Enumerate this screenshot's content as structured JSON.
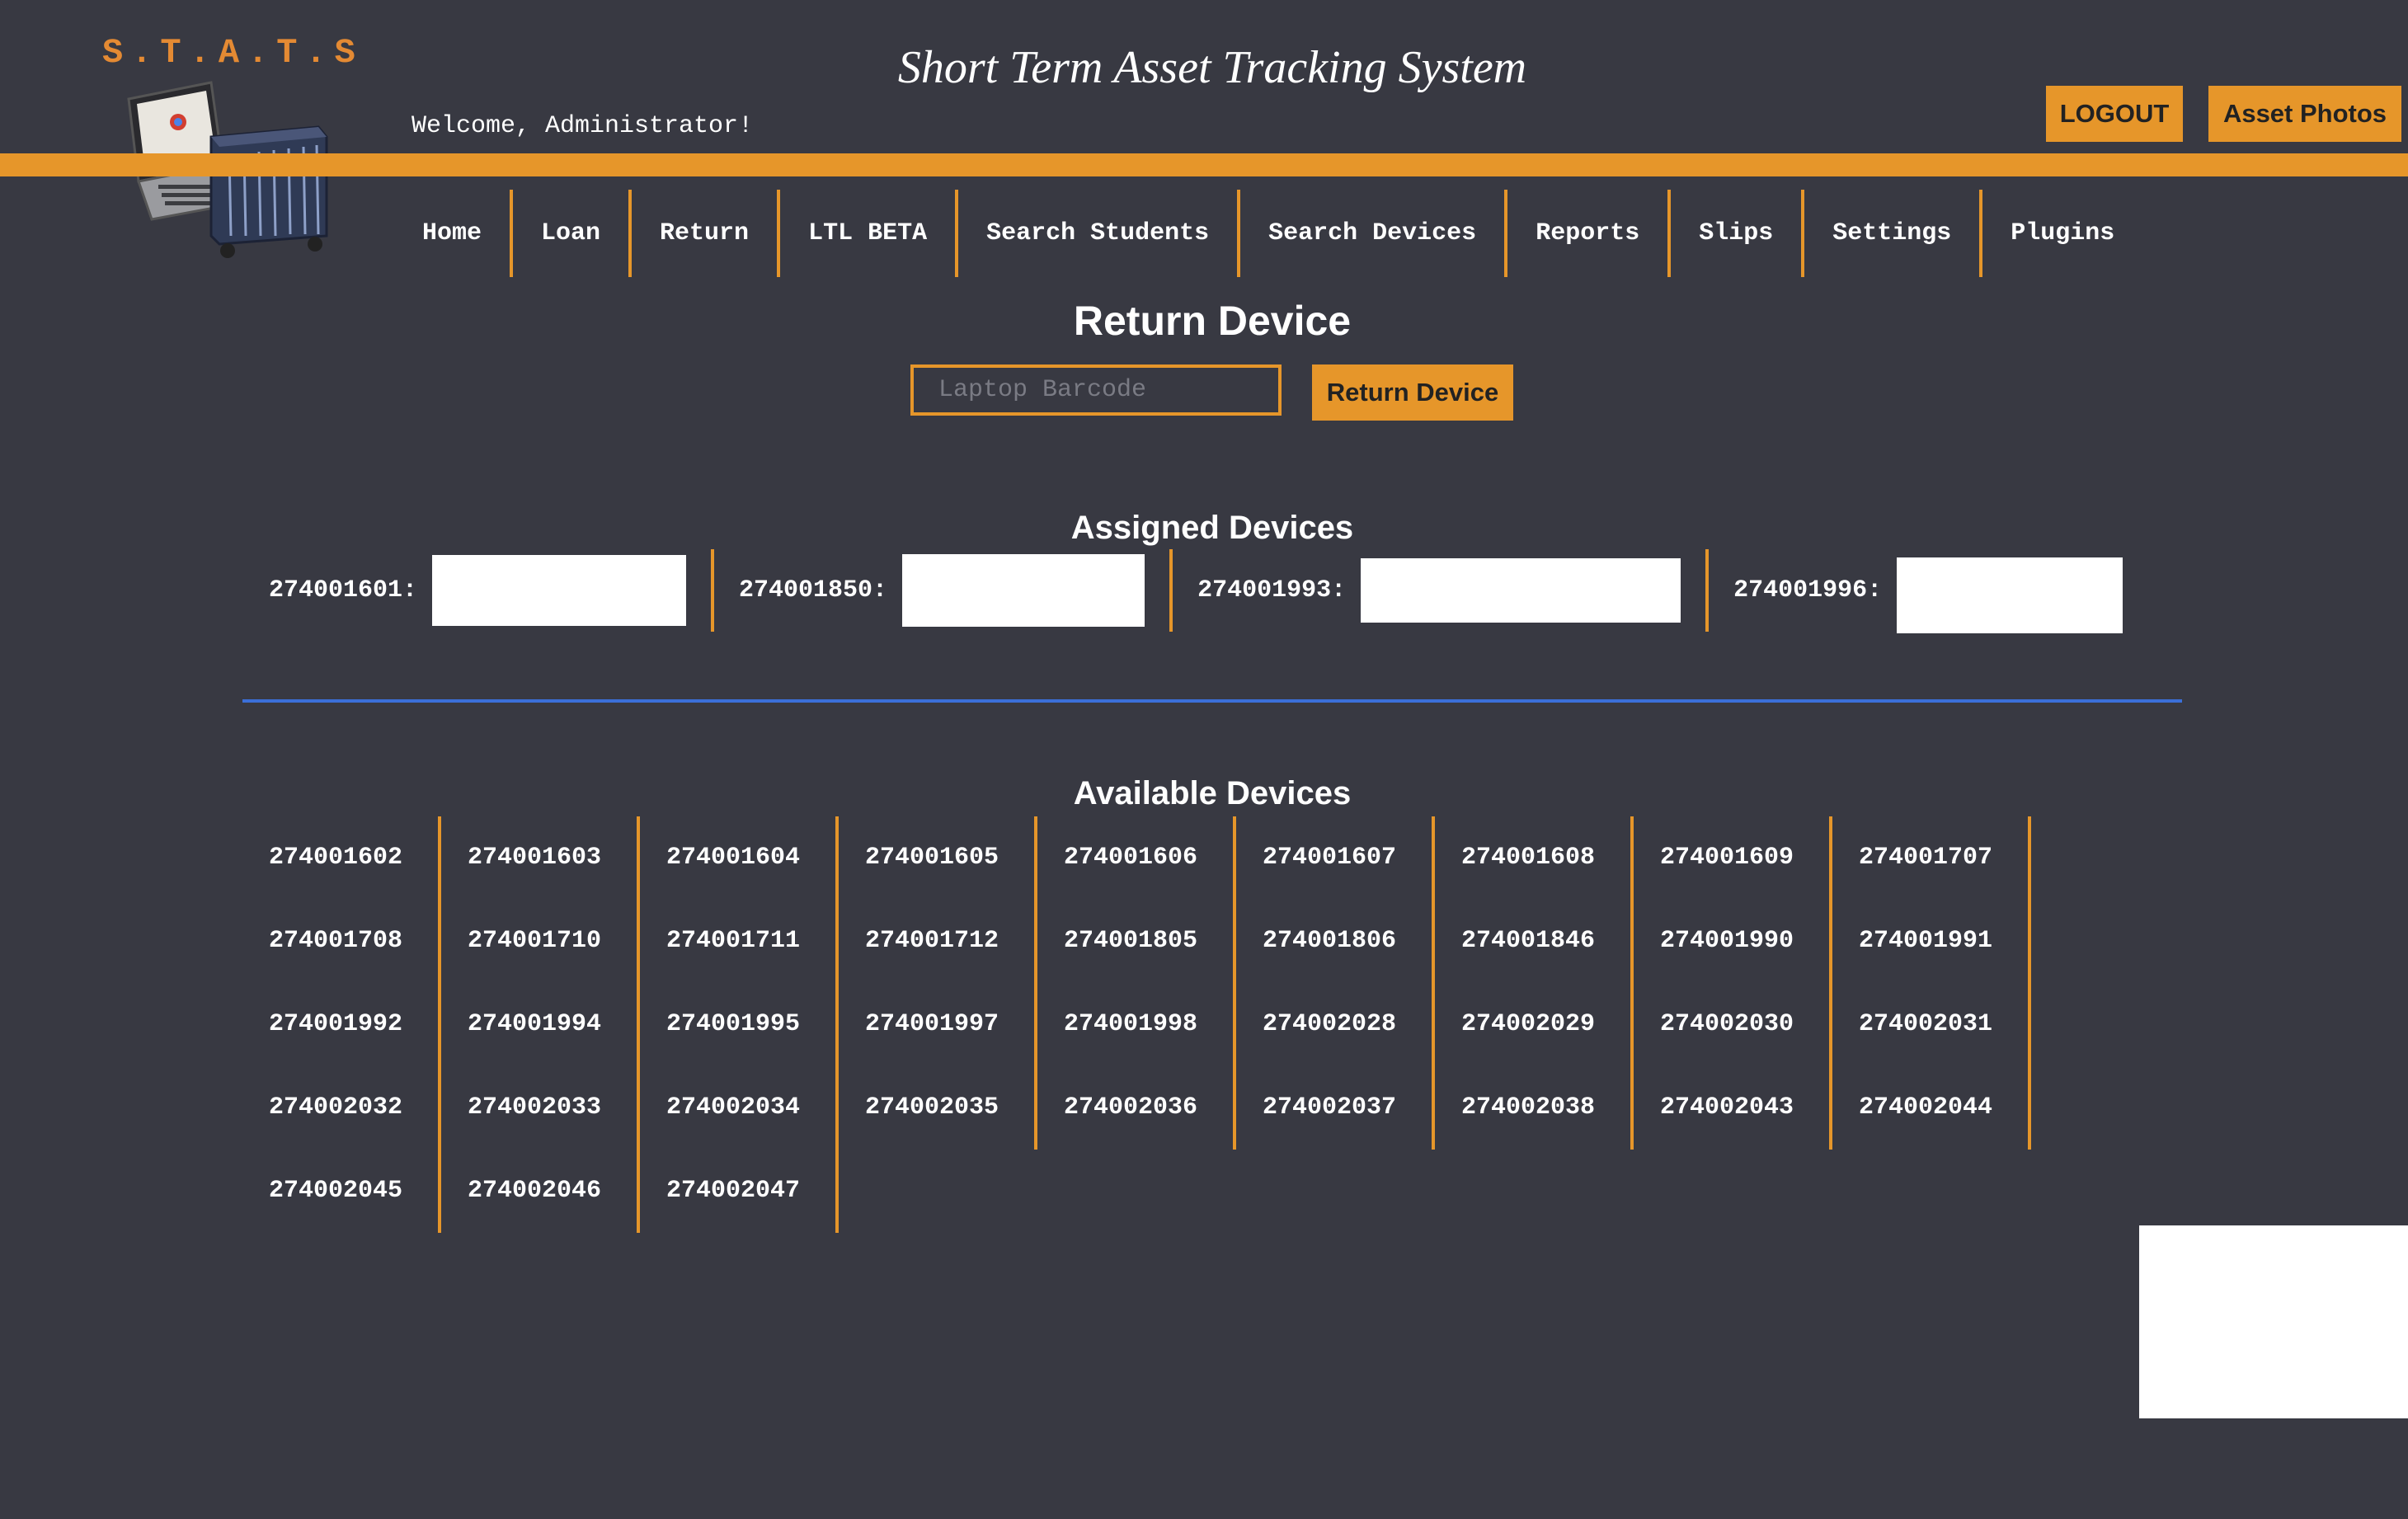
{
  "header": {
    "brand": "S.T.A.T.S",
    "title": "Short Term Asset Tracking System",
    "welcome": "Welcome, Administrator!",
    "logout_label": "LOGOUT",
    "asset_photos_label": "Asset Photos"
  },
  "nav": {
    "items": [
      {
        "label": "Home"
      },
      {
        "label": "Loan"
      },
      {
        "label": "Return"
      },
      {
        "label": "LTL BETA"
      },
      {
        "label": "Search Students"
      },
      {
        "label": "Search Devices"
      },
      {
        "label": "Reports"
      },
      {
        "label": "Slips"
      },
      {
        "label": "Settings"
      },
      {
        "label": "Plugins"
      }
    ]
  },
  "page": {
    "heading": "Return Device",
    "barcode_placeholder": "Laptop Barcode",
    "return_button_label": "Return Device"
  },
  "assigned": {
    "heading": "Assigned Devices",
    "devices": [
      {
        "label": "274001601:"
      },
      {
        "label": "274001850:"
      },
      {
        "label": "274001993:"
      },
      {
        "label": "274001996:"
      }
    ]
  },
  "available": {
    "heading": "Available Devices",
    "devices": [
      "274001602",
      "274001603",
      "274001604",
      "274001605",
      "274001606",
      "274001607",
      "274001608",
      "274001609",
      "274001707",
      "274001708",
      "274001710",
      "274001711",
      "274001712",
      "274001805",
      "274001806",
      "274001846",
      "274001990",
      "274001991",
      "274001992",
      "274001994",
      "274001995",
      "274001997",
      "274001998",
      "274002028",
      "274002029",
      "274002030",
      "274002031",
      "274002032",
      "274002033",
      "274002034",
      "274002035",
      "274002036",
      "274002037",
      "274002038",
      "274002043",
      "274002044",
      "274002045",
      "274002046",
      "274002047"
    ]
  },
  "colors": {
    "background": "#383942",
    "accent": "#e6962a",
    "divider": "#3b6fd8"
  }
}
